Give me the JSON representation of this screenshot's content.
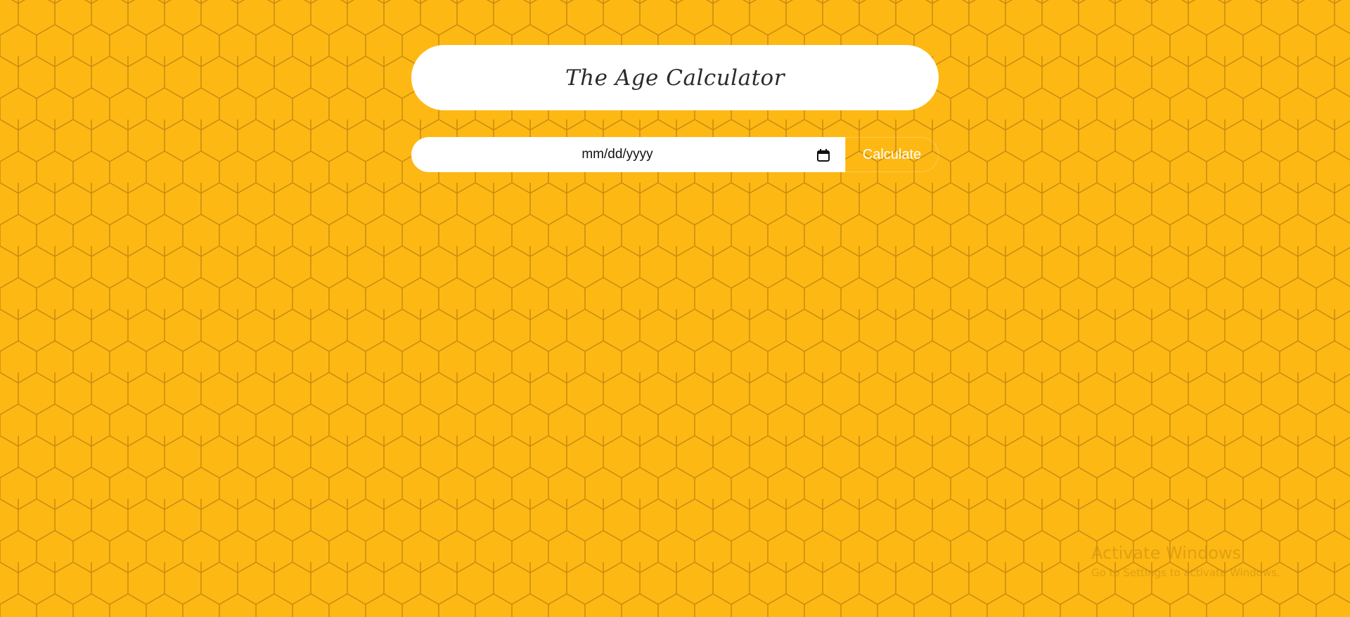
{
  "page": {
    "title": "The Age Calculator",
    "background_color": "#fdb813",
    "honeycomb_line_color": "#c98a12"
  },
  "form": {
    "date_placeholder": "mm/dd/yyyy",
    "calendar_icon": "calendar-icon",
    "calculate_label": "Calculate"
  },
  "watermark": {
    "title": "Activate Windows",
    "subtitle": "Go to Settings to activate Windows."
  }
}
